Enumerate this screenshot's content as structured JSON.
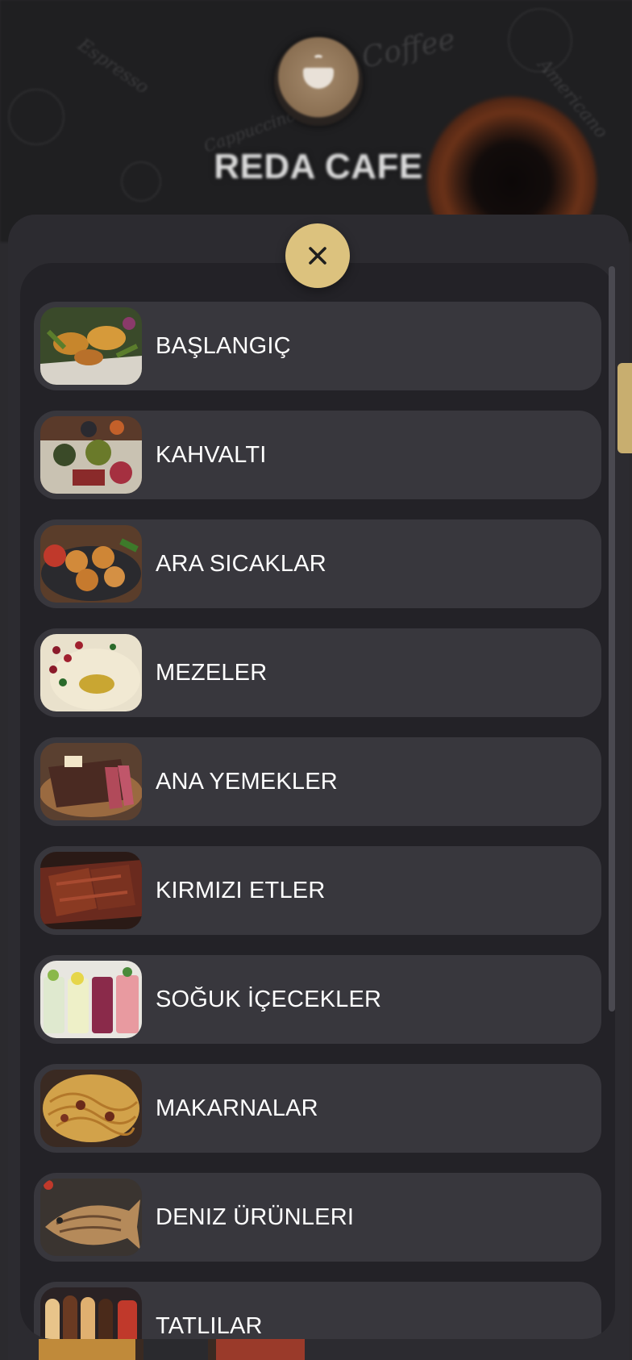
{
  "header": {
    "brand_name": "REDA CAFE",
    "doodle_words": [
      "Coffee",
      "Espresso",
      "Americano",
      "Cappuccino"
    ]
  },
  "colors": {
    "accent": "#dcc27e",
    "modal_bg": "#232227",
    "item_bg": "#38373d",
    "text": "#ffffff"
  },
  "close_button": {
    "icon": "close-icon"
  },
  "categories": [
    {
      "label": "BAŞLANGIÇ",
      "thumb": "starter-icon"
    },
    {
      "label": "KAHVALTI",
      "thumb": "breakfast-icon"
    },
    {
      "label": "ARA SICAKLAR",
      "thumb": "hot-appetizer-icon"
    },
    {
      "label": "MEZELER",
      "thumb": "meze-icon"
    },
    {
      "label": "ANA YEMEKLER",
      "thumb": "main-dish-icon"
    },
    {
      "label": "KIRMIZI ETLER",
      "thumb": "red-meat-icon"
    },
    {
      "label": "SOĞUK İÇECEKLER",
      "thumb": "cold-drink-icon"
    },
    {
      "label": "MAKARNALAR",
      "thumb": "pasta-icon"
    },
    {
      "label": "DENIZ ÜRÜNLERI",
      "thumb": "seafood-icon"
    },
    {
      "label": "TATLILAR",
      "thumb": "dessert-icon"
    }
  ]
}
